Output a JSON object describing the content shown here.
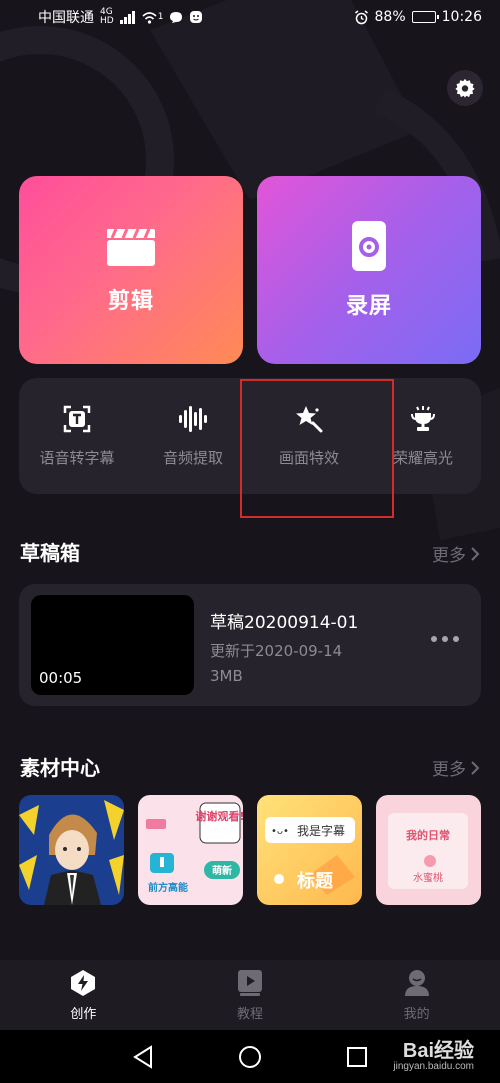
{
  "status_bar": {
    "carrier": "中国联通",
    "network_tag_top": "4G",
    "network_tag_bottom": "HD",
    "notification_count": "1",
    "battery_percent": "88%",
    "battery_level": 0.88,
    "time": "10:26"
  },
  "main_cards": {
    "edit_label": "剪辑",
    "record_label": "录屏"
  },
  "tools": [
    {
      "label": "语音转字幕",
      "icon": "speech-to-text-icon"
    },
    {
      "label": "音频提取",
      "icon": "audio-waveform-icon"
    },
    {
      "label": "画面特效",
      "icon": "star-effect-icon"
    },
    {
      "label": "荣耀高光",
      "icon": "trophy-icon"
    }
  ],
  "drafts": {
    "title": "草稿箱",
    "more_label": "更多",
    "item": {
      "name": "草稿20200914-01",
      "updated": "更新于2020-09-14",
      "size": "3MB",
      "duration": "00:05"
    }
  },
  "materials": {
    "title": "素材中心",
    "more_label": "更多",
    "items": [
      {
        "texts": []
      },
      {
        "texts": [
          "谢谢观看!",
          "萌新",
          "前方高能"
        ]
      },
      {
        "texts": [
          "我是字幕",
          "标题"
        ]
      },
      {
        "texts": [
          "我的日常",
          "水蜜桃"
        ]
      }
    ]
  },
  "bottom_nav": [
    {
      "label": "创作",
      "active": true
    },
    {
      "label": "教程",
      "active": false
    },
    {
      "label": "我的",
      "active": false
    }
  ],
  "watermark": {
    "main": "Bai经验",
    "sub": "jingyan.baidu.com"
  },
  "colors": {
    "background": "#17141c",
    "edit_card_gradient": [
      "#ff4e9b",
      "#ff8a55"
    ],
    "record_card_gradient": [
      "#e255d8",
      "#7a6cf5"
    ],
    "highlight_box": "#d42b2b"
  }
}
